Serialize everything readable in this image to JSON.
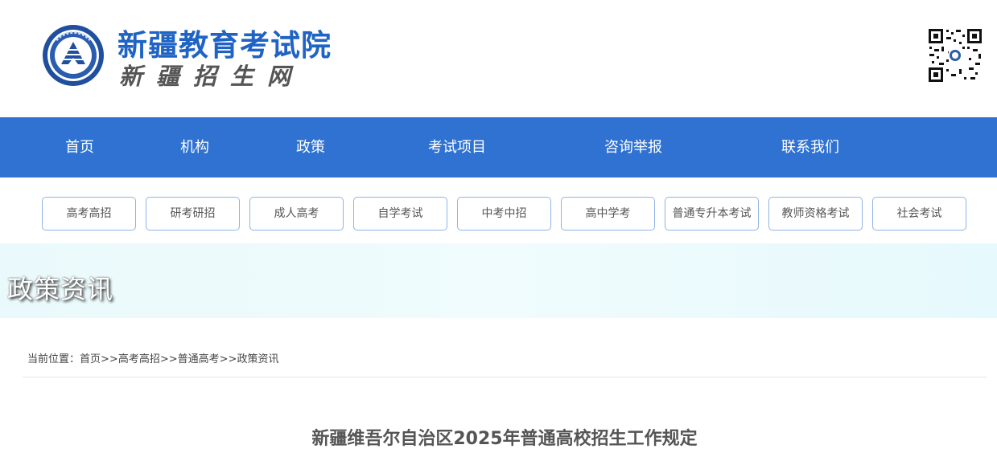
{
  "header": {
    "brand_title": "新疆教育考试院",
    "brand_subtitle": "新疆招生网",
    "logo_icon": "exam-authority-emblem-icon",
    "qr_icon": "qr-code-icon",
    "colors": {
      "brand_blue": "#1f63c4",
      "nav_blue": "#2f72d2"
    }
  },
  "nav": {
    "items": [
      {
        "label": "首页"
      },
      {
        "label": "机构"
      },
      {
        "label": "政策"
      },
      {
        "label": "考试项目"
      },
      {
        "label": "咨询举报"
      },
      {
        "label": "联系我们"
      }
    ]
  },
  "categories": [
    {
      "label": "高考高招"
    },
    {
      "label": "研考研招"
    },
    {
      "label": "成人高考"
    },
    {
      "label": "自学考试"
    },
    {
      "label": "中考中招"
    },
    {
      "label": "高中学考"
    },
    {
      "label": "普通专升本考试"
    },
    {
      "label": "教师资格考试"
    },
    {
      "label": "社会考试"
    }
  ],
  "banner": {
    "title": "政策资讯"
  },
  "breadcrumb": {
    "prefix": "当前位置：",
    "items": [
      "首页",
      "高考高招",
      "普通高考",
      "政策资讯"
    ],
    "separator": ">>"
  },
  "article": {
    "title": "新疆维吾尔自治区2025年普通高校招生工作规定"
  }
}
